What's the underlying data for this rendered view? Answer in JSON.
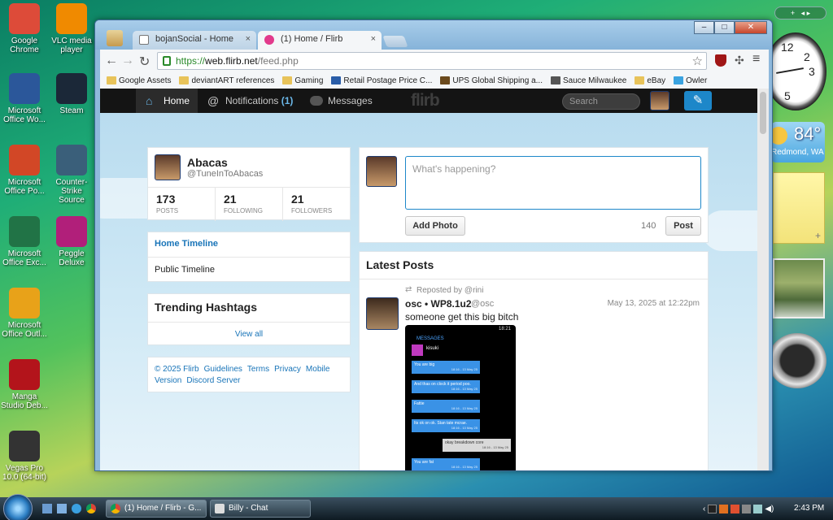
{
  "desktop": {
    "icons": [
      {
        "label": "Google Chrome",
        "icon": "chrome-icon",
        "color": "#dd4b39"
      },
      {
        "label": "VLC media player",
        "icon": "vlc-icon",
        "color": "#f08a00"
      },
      {
        "label": "Microsoft Office Wo...",
        "icon": "word-icon",
        "color": "#2b579a"
      },
      {
        "label": "Steam",
        "icon": "steam-icon",
        "color": "#1b2838"
      },
      {
        "label": "Microsoft Office Po...",
        "icon": "powerpoint-icon",
        "color": "#d24726"
      },
      {
        "label": "Counter-Strike Source",
        "icon": "counter-strike-icon",
        "color": "#3a5f7a"
      },
      {
        "label": "Microsoft Office Exc...",
        "icon": "excel-icon",
        "color": "#217346"
      },
      {
        "label": "Peggle Deluxe",
        "icon": "peggle-icon",
        "color": "#b11f7a"
      },
      {
        "label": "Microsoft Office Outl...",
        "icon": "outlook-icon",
        "color": "#e8a219"
      },
      {
        "label": "Manga Studio Deb...",
        "icon": "manga-studio-icon",
        "color": "#b3141b"
      },
      {
        "label": "Vegas Pro 10.0 (64-bit)",
        "icon": "vegas-pro-icon",
        "color": "#333333"
      }
    ],
    "weather": {
      "temp": "84°",
      "city": "Redmond, WA"
    },
    "clock_numbers": [
      "12",
      "2",
      "3",
      "5"
    ]
  },
  "browser": {
    "tabs": [
      {
        "label": "bojanSocial - Home",
        "active": false
      },
      {
        "label": "(1) Home / Flirb",
        "active": true
      }
    ],
    "tab_close": "×",
    "url": {
      "scheme": "https://",
      "host": "web.flirb.net",
      "path": "/feed.php"
    },
    "star": "☆",
    "bookmarks": [
      {
        "label": "Google Assets",
        "icon": "folder-icon",
        "color": "#e8c35a"
      },
      {
        "label": "deviantART references",
        "icon": "folder-icon",
        "color": "#e8c35a"
      },
      {
        "label": "Gaming",
        "icon": "folder-icon",
        "color": "#e8c35a"
      },
      {
        "label": "Retail Postage Price C...",
        "icon": "postal-icon",
        "color": "#2a5da8"
      },
      {
        "label": "UPS Global Shipping a...",
        "icon": "ups-icon",
        "color": "#6b4a1d"
      },
      {
        "label": "Sauce Milwaukee",
        "icon": "box-icon",
        "color": "#555555"
      },
      {
        "label": "eBay",
        "icon": "folder-icon",
        "color": "#e8c35a"
      },
      {
        "label": "Owler",
        "icon": "owler-icon",
        "color": "#3aa3e0"
      }
    ],
    "nav": {
      "back": "←",
      "forward": "→",
      "reload": "↻",
      "menu": "≡"
    },
    "window_controls": {
      "minimize": "–",
      "maximize": "□",
      "close": "✕"
    }
  },
  "site": {
    "logo": "flirb",
    "nav": {
      "home": "Home",
      "notifications": "Notifications",
      "notification_count": "(1)",
      "messages": "Messages",
      "search_placeholder": "Search"
    },
    "colors": {
      "accent": "#1d87c9",
      "nav_bg": "#141414",
      "link": "#1874b8"
    },
    "profile": {
      "name": "Abacas",
      "handle": "@TuneInToAbacas",
      "stats": [
        {
          "value": "173",
          "label": "POSTS"
        },
        {
          "value": "21",
          "label": "FOLLOWING"
        },
        {
          "value": "21",
          "label": "FOLLOWERS"
        }
      ]
    },
    "timelines": [
      "Home Timeline",
      "Public Timeline"
    ],
    "trending": {
      "title": "Trending Hashtags",
      "view_all": "View all"
    },
    "footer_links": [
      "© 2025 Flirb",
      "Guidelines",
      "Terms",
      "Privacy",
      "Mobile Version",
      "Discord Server"
    ],
    "composer": {
      "placeholder": "What's happening?",
      "add_photo": "Add Photo",
      "char_count": "140",
      "post": "Post"
    },
    "feed": {
      "title": "Latest Posts",
      "posts": [
        {
          "reposted_by": "Reposted by @rini",
          "name": "osc • WP8.1u2",
          "handle": "@osc",
          "time": "May 13, 2025 at 12:22pm",
          "text": "someone get this big bitch",
          "screenshot": {
            "time": "18:21",
            "header": "MESSAGES",
            "contact": "kisuki",
            "bubbles": [
              {
                "text": "You are big",
                "meta": "18:16 - 13 May 25",
                "mine": true
              },
              {
                "text": "And thas on clock it period poo.",
                "meta": "18:16 - 13 May 25",
                "mine": true
              },
              {
                "text": "Fattie",
                "meta": "18:16 - 13 May 25",
                "mine": true
              },
              {
                "text": "Its ok on ok. Stan tate mcrae.",
                "meta": "18:16 - 13 May 25",
                "mine": true
              },
              {
                "text": "okay breakdown core",
                "meta": "18:16 - 13 May 25",
                "mine": false
              },
              {
                "text": "You are fat",
                "meta": "18:16 - 13 May 25",
                "mine": true
              }
            ]
          }
        }
      ]
    }
  },
  "taskbar": {
    "tasks": [
      {
        "label": "(1) Home / Flirb - G...",
        "icon": "chrome-icon"
      },
      {
        "label": "Billy - Chat",
        "icon": "chat-icon"
      }
    ],
    "clock": "2:43 PM"
  }
}
